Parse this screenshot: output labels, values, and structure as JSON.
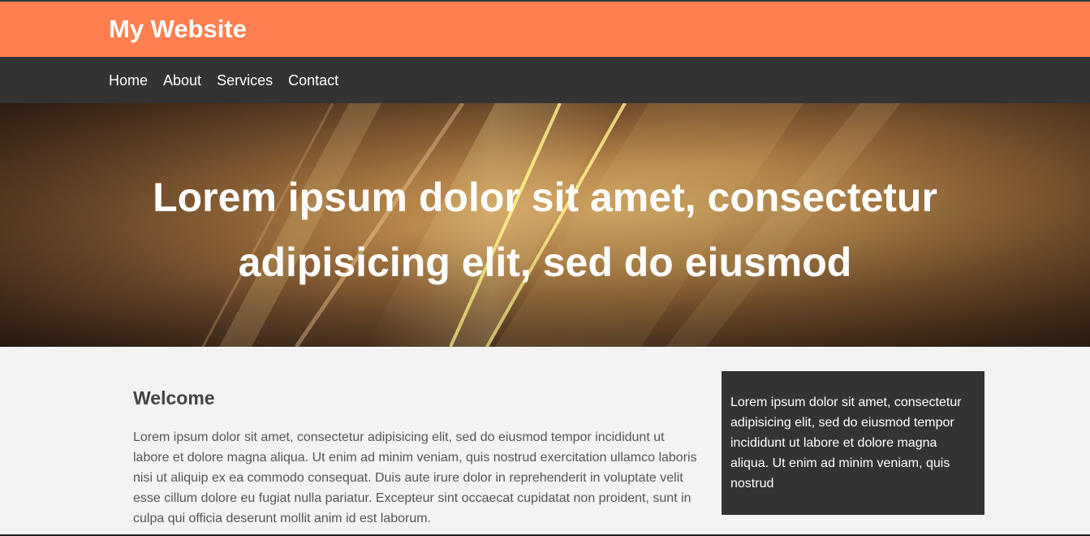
{
  "header": {
    "title": "My Website"
  },
  "nav": {
    "items": [
      {
        "label": "Home"
      },
      {
        "label": "About"
      },
      {
        "label": "Services"
      },
      {
        "label": "Contact"
      }
    ]
  },
  "hero": {
    "heading": "Lorem ipsum dolor sit amet, consectetur adipisicing elit, sed do eiusmod"
  },
  "main": {
    "title": "Welcome",
    "paragraph": "Lorem ipsum dolor sit amet, consectetur adipisicing elit, sed do eiusmod tempor incididunt ut labore et dolore magna aliqua. Ut enim ad minim veniam, quis nostrud exercitation ullamco laboris nisi ut aliquip ex ea commodo consequat. Duis aute irure dolor in reprehenderit in voluptate velit esse cillum dolore eu fugiat nulla pariatur. Excepteur sint occaecat cupidatat non proident, sunt in culpa qui officia deserunt mollit anim id est laborum."
  },
  "sidebar": {
    "text": "Lorem ipsum dolor sit amet, consectetur adipisicing elit, sed do eiusmod tempor incididunt ut labore et dolore magna aliqua. Ut enim ad minim veniam, quis nostrud"
  },
  "colors": {
    "header_bg": "#ff7f50",
    "nav_bg": "#333333",
    "page_bg": "#f3f3f3",
    "sidebar_bg": "#333333"
  }
}
